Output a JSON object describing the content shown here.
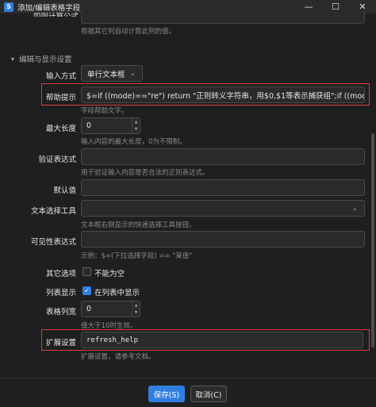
{
  "window": {
    "title": "添加/编辑表格字段",
    "app_icon": "S",
    "minimize": "—",
    "maximize": "☐",
    "close": "✕"
  },
  "top": {
    "label": "四则计算公式",
    "hint": "根据其它列自动计算此列的值。"
  },
  "section": {
    "title": "编辑与显示设置"
  },
  "fields": {
    "input_mode": {
      "label": "输入方式",
      "value": "单行文本框"
    },
    "help_hint": {
      "label": "帮助提示",
      "value": "$=if ((mode)==\"re\") return \"正则转义字符串，用$0,$1等表示捕获组\";if ((mode)==\"r",
      "hint": "字段帮助文字。"
    },
    "max_length": {
      "label": "最大长度",
      "value": "0",
      "hint": "输入内容的最大长度，0为不限制。"
    },
    "validation": {
      "label": "验证表达式",
      "value": "",
      "hint": "用于验证输入内容是否合法的正则表达式。"
    },
    "default_value": {
      "label": "默认值",
      "value": ""
    },
    "text_tools": {
      "label": "文本选择工具",
      "value": "",
      "hint": "文本框右侧显示的快速选择工具按钮。"
    },
    "visibility": {
      "label": "可见性表达式",
      "value": "",
      "hint": "示例：$=(下拉选择字段) == \"某值\""
    },
    "other_options": {
      "label": "其它选项",
      "checkbox_label": "不能为空",
      "checked": false
    },
    "list_display": {
      "label": "列表显示",
      "checkbox_label": "在列表中显示",
      "checked": true
    },
    "column_width": {
      "label": "表格列宽",
      "value": "0",
      "hint": "值大于10时生效。"
    },
    "extension": {
      "label": "扩展设置",
      "value": "refresh_help",
      "hint": "扩展设置，请参考文档。"
    }
  },
  "footer": {
    "save_label": "保存(S)",
    "cancel_label": "取消(C)"
  },
  "colors": {
    "accent": "#2f7fe0",
    "highlight": "#e23b3b",
    "background": "#1f1f1f"
  }
}
